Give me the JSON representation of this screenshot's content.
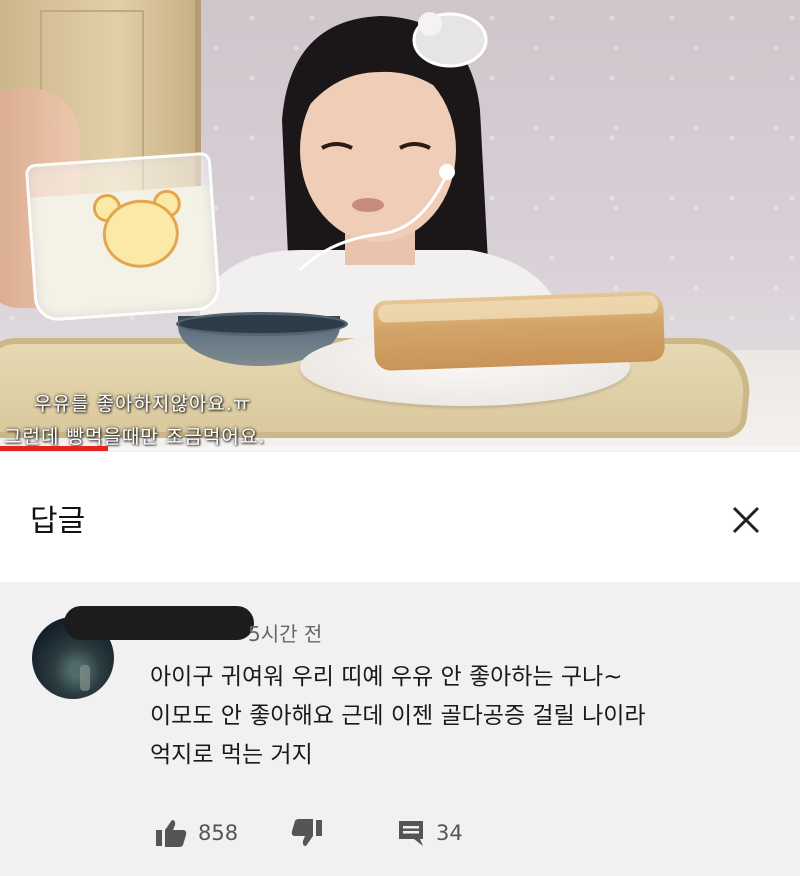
{
  "video": {
    "subtitle_line1": "우유를 좋아하지않아요.ㅠ",
    "subtitle_line2": "그런데 빵먹을때만 조금먹어요.",
    "progress": 0.135,
    "progress_color": "#e3251d"
  },
  "reply_panel": {
    "title": "답글",
    "close_icon": "close-icon"
  },
  "comment": {
    "timestamp": "5시간 전",
    "lines": [
      "아이구 귀여워 우리 띠예 우유 안 좋아하는 구나~",
      "이모도 안 좋아해요 근데 이젠 골다공증 걸릴 나이라",
      "억지로 먹는 거지"
    ],
    "likes": "858",
    "replies": "34",
    "icons": {
      "like": "thumbs-up-icon",
      "dislike": "thumbs-down-icon",
      "reply": "comment-icon"
    }
  }
}
